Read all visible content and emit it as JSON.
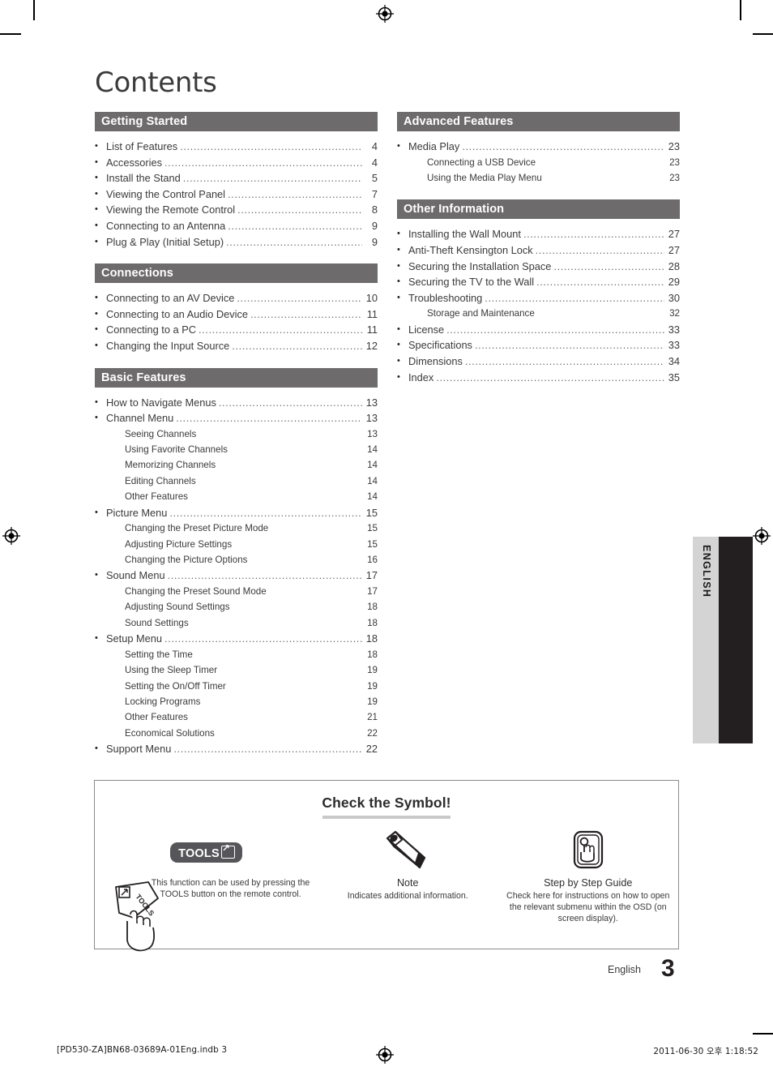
{
  "page_title": "Contents",
  "side_tab": {
    "label": "ENGLISH"
  },
  "footer": {
    "language": "English",
    "page_number": "3",
    "print_left": "[PD530-ZA]BN68-03689A-01Eng.indb   3",
    "print_right": "2011-06-30   오후 1:18:52"
  },
  "colors": {
    "section_bar": "#6d6b6b",
    "side_tab_bg": "#d4d4d4",
    "side_tab_black": "#231f20",
    "text": "#3a3a3a"
  },
  "left_column": [
    {
      "heading": "Getting Started",
      "entries": [
        {
          "level": 1,
          "label": "List of Features",
          "page": "4"
        },
        {
          "level": 1,
          "label": "Accessories",
          "page": "4"
        },
        {
          "level": 1,
          "label": "Install the Stand",
          "page": "5"
        },
        {
          "level": 1,
          "label": "Viewing the Control Panel",
          "page": "7"
        },
        {
          "level": 1,
          "label": "Viewing the Remote Control",
          "page": "8"
        },
        {
          "level": 1,
          "label": "Connecting to an Antenna",
          "page": "9"
        },
        {
          "level": 1,
          "label": "Plug & Play (Initial Setup)",
          "page": "9"
        }
      ]
    },
    {
      "heading": "Connections",
      "entries": [
        {
          "level": 1,
          "label": "Connecting to an AV Device",
          "page": "10"
        },
        {
          "level": 1,
          "label": "Connecting to an Audio Device",
          "page": "11"
        },
        {
          "level": 1,
          "label": "Connecting to a PC",
          "page": "11"
        },
        {
          "level": 1,
          "label": "Changing the Input Source",
          "page": "12"
        }
      ]
    },
    {
      "heading": "Basic Features",
      "entries": [
        {
          "level": 1,
          "label": "How to Navigate Menus",
          "page": "13"
        },
        {
          "level": 1,
          "label": "Channel Menu",
          "page": "13"
        },
        {
          "level": 2,
          "label": "Seeing Channels",
          "page": "13"
        },
        {
          "level": 2,
          "label": "Using Favorite Channels",
          "page": "14"
        },
        {
          "level": 2,
          "label": "Memorizing Channels",
          "page": "14"
        },
        {
          "level": 2,
          "label": "Editing Channels",
          "page": "14"
        },
        {
          "level": 2,
          "label": "Other Features",
          "page": "14"
        },
        {
          "level": 1,
          "label": "Picture Menu",
          "page": "15"
        },
        {
          "level": 2,
          "label": "Changing the Preset Picture Mode",
          "page": "15"
        },
        {
          "level": 2,
          "label": "Adjusting Picture Settings",
          "page": "15"
        },
        {
          "level": 2,
          "label": "Changing the Picture Options",
          "page": "16"
        },
        {
          "level": 1,
          "label": "Sound Menu",
          "page": "17"
        },
        {
          "level": 2,
          "label": "Changing the Preset Sound Mode",
          "page": "17"
        },
        {
          "level": 2,
          "label": "Adjusting Sound Settings",
          "page": "18"
        },
        {
          "level": 2,
          "label": "Sound Settings",
          "page": "18"
        },
        {
          "level": 1,
          "label": "Setup Menu",
          "page": "18"
        },
        {
          "level": 2,
          "label": "Setting the Time",
          "page": "18"
        },
        {
          "level": 2,
          "label": "Using the Sleep Timer",
          "page": "19"
        },
        {
          "level": 2,
          "label": "Setting the On/Off Timer",
          "page": "19"
        },
        {
          "level": 2,
          "label": "Locking Programs",
          "page": "19"
        },
        {
          "level": 2,
          "label": "Other Features",
          "page": "21"
        },
        {
          "level": 2,
          "label": "Economical Solutions",
          "page": "22"
        },
        {
          "level": 1,
          "label": "Support Menu",
          "page": "22"
        }
      ]
    }
  ],
  "right_column": [
    {
      "heading": "Advanced Features",
      "entries": [
        {
          "level": 1,
          "label": "Media Play",
          "page": "23"
        },
        {
          "level": 2,
          "label": "Connecting a USB Device",
          "page": "23"
        },
        {
          "level": 2,
          "label": "Using the Media Play Menu",
          "page": "23"
        }
      ]
    },
    {
      "heading": "Other Information",
      "entries": [
        {
          "level": 1,
          "label": "Installing the Wall Mount",
          "page": "27"
        },
        {
          "level": 1,
          "label": "Anti-Theft Kensington Lock",
          "page": "27"
        },
        {
          "level": 1,
          "label": "Securing the Installation Space",
          "page": "28"
        },
        {
          "level": 1,
          "label": "Securing the TV to the Wall",
          "page": "29"
        },
        {
          "level": 1,
          "label": "Troubleshooting",
          "page": "30"
        },
        {
          "level": 2,
          "label": "Storage and Maintenance",
          "page": "32"
        },
        {
          "level": 1,
          "label": "License",
          "page": "33"
        },
        {
          "level": 1,
          "label": "Specifications",
          "page": "33"
        },
        {
          "level": 1,
          "label": "Dimensions",
          "page": "34"
        },
        {
          "level": 1,
          "label": "Index",
          "page": "35"
        }
      ]
    }
  ],
  "symbol_box": {
    "title": "Check the Symbol!",
    "items": [
      {
        "icon": "tools-pill-icon",
        "badge": "TOOLS",
        "heading": "",
        "desc": "This function can be used by pressing the TOOLS button on the remote control."
      },
      {
        "icon": "pencil-icon",
        "badge": "",
        "heading": "Note",
        "desc": "Indicates additional information."
      },
      {
        "icon": "step-guide-icon",
        "badge": "",
        "heading": "Step by Step Guide",
        "desc": "Check here for instructions on how to open the relevant submenu within the OSD (on screen display)."
      }
    ]
  }
}
